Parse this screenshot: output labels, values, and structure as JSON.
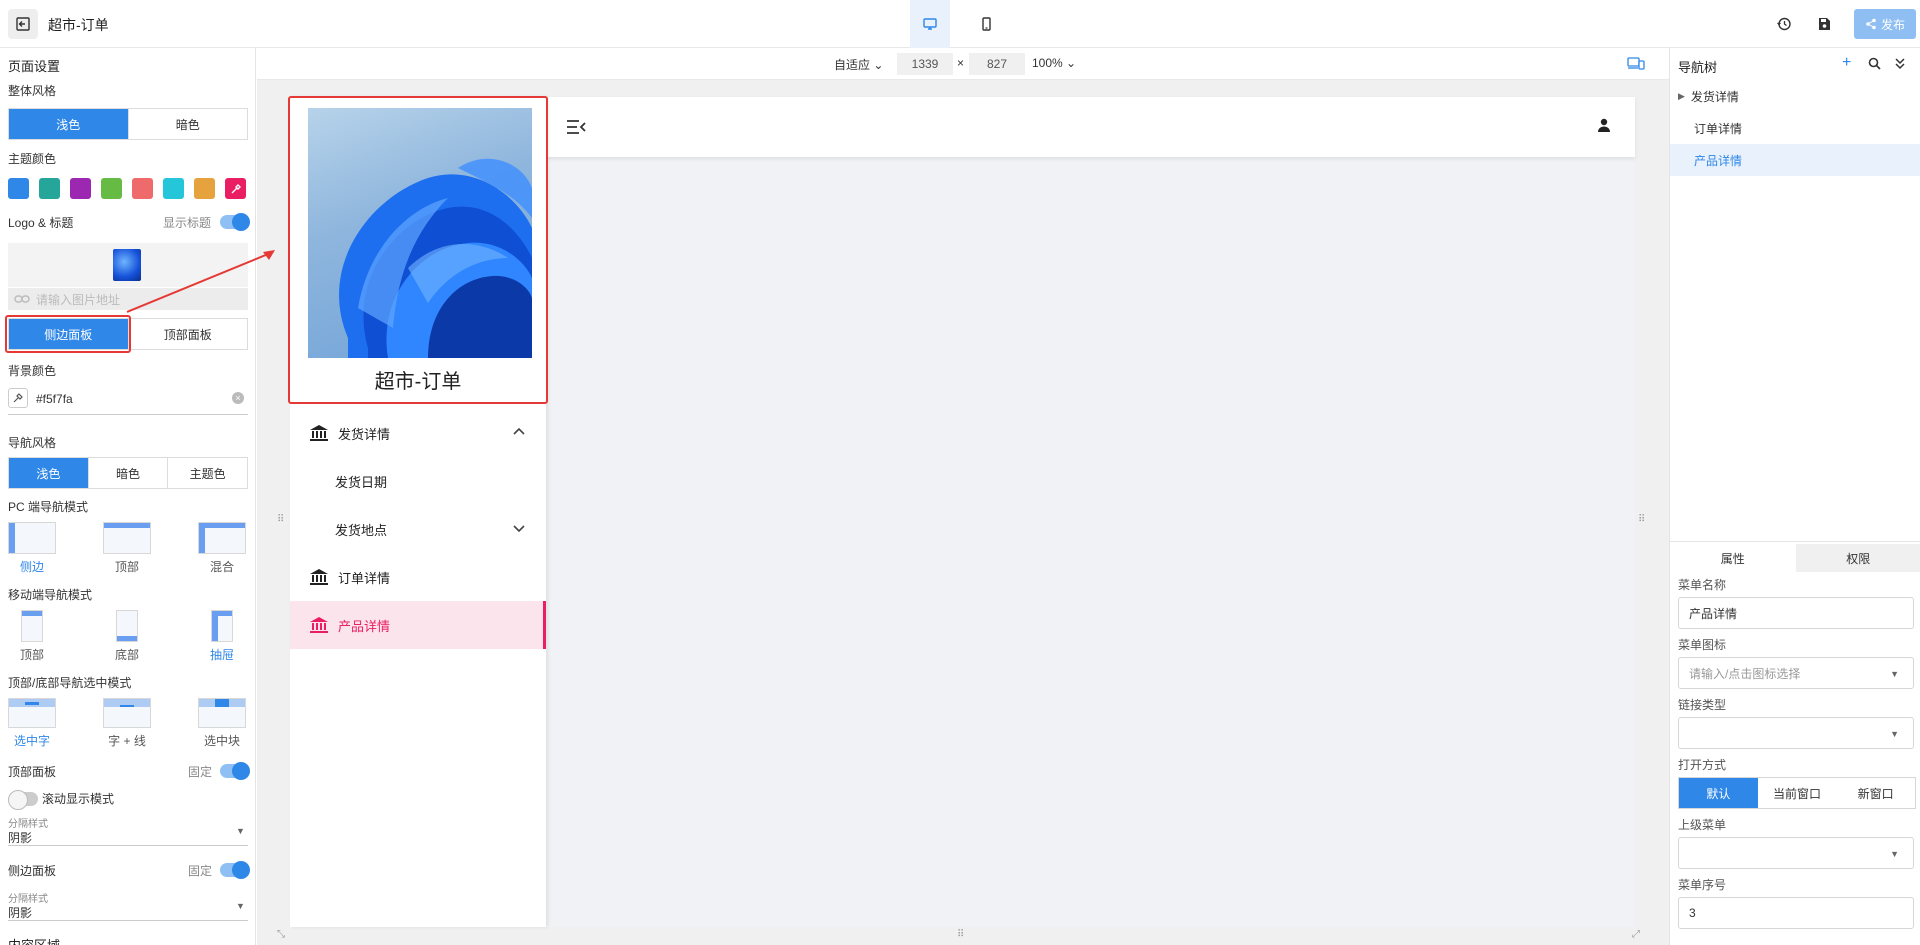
{
  "app": {
    "title": "超市-订单",
    "publish_label": "发布"
  },
  "left": {
    "page_settings": "页面设置",
    "overall_style": "整体风格",
    "style_options": [
      "浅色",
      "暗色"
    ],
    "theme_color": "主题颜色",
    "swatches": [
      "#2f87e8",
      "#26a69a",
      "#9c27b0",
      "#66bb44",
      "#ef6b6b",
      "#26c6da",
      "#e6a23c",
      "#e91e63"
    ],
    "logo_title": "Logo & 标题",
    "show_title": "显示标题",
    "url_placeholder": "请输入图片地址",
    "panel_options": [
      "侧边面板",
      "顶部面板"
    ],
    "bg_color": "背景颜色",
    "bg_value": "#f5f7fa",
    "nav_style": "导航风格",
    "nav_style_options": [
      "浅色",
      "暗色",
      "主题色"
    ],
    "pc_nav_mode": "PC 端导航模式",
    "pc_modes": [
      "侧边",
      "顶部",
      "混合"
    ],
    "mobile_nav_mode": "移动端导航模式",
    "mobile_modes": [
      "顶部",
      "底部",
      "抽屉"
    ],
    "select_mode": "顶部/底部导航选中模式",
    "select_modes": [
      "选中字",
      "字 + 线",
      "选中块"
    ],
    "top_panel": "顶部面板",
    "fixed": "固定",
    "scroll_mode": "滚动显示模式",
    "separator_caption": "分隔样式",
    "separator_value": "阴影",
    "side_panel": "侧边面板",
    "content_area": "内容区域"
  },
  "canvas": {
    "fit": "自适应",
    "width": "1339",
    "times": "×",
    "height": "827",
    "zoom": "100%"
  },
  "preview": {
    "site_title": "超市-订单",
    "menu": [
      {
        "label": "发货详情",
        "level": 1,
        "expanded": true
      },
      {
        "label": "发货日期",
        "level": 2
      },
      {
        "label": "发货地点",
        "level": 2,
        "expandable": true
      },
      {
        "label": "订单详情",
        "level": 1
      },
      {
        "label": "产品详情",
        "level": 1,
        "active": true
      }
    ]
  },
  "right": {
    "nav_tree": "导航树",
    "tree_items": [
      "发货详情",
      "订单详情",
      "产品详情"
    ],
    "tabs": [
      "属性",
      "权限"
    ],
    "menu_name_label": "菜单名称",
    "menu_name_value": "产品详情",
    "menu_icon_label": "菜单图标",
    "menu_icon_placeholder": "请输入/点击图标选择",
    "link_type_label": "链接类型",
    "open_mode_label": "打开方式",
    "open_modes": [
      "默认",
      "当前窗口",
      "新窗口"
    ],
    "parent_menu_label": "上级菜单",
    "order_label": "菜单序号",
    "order_value": "3"
  }
}
